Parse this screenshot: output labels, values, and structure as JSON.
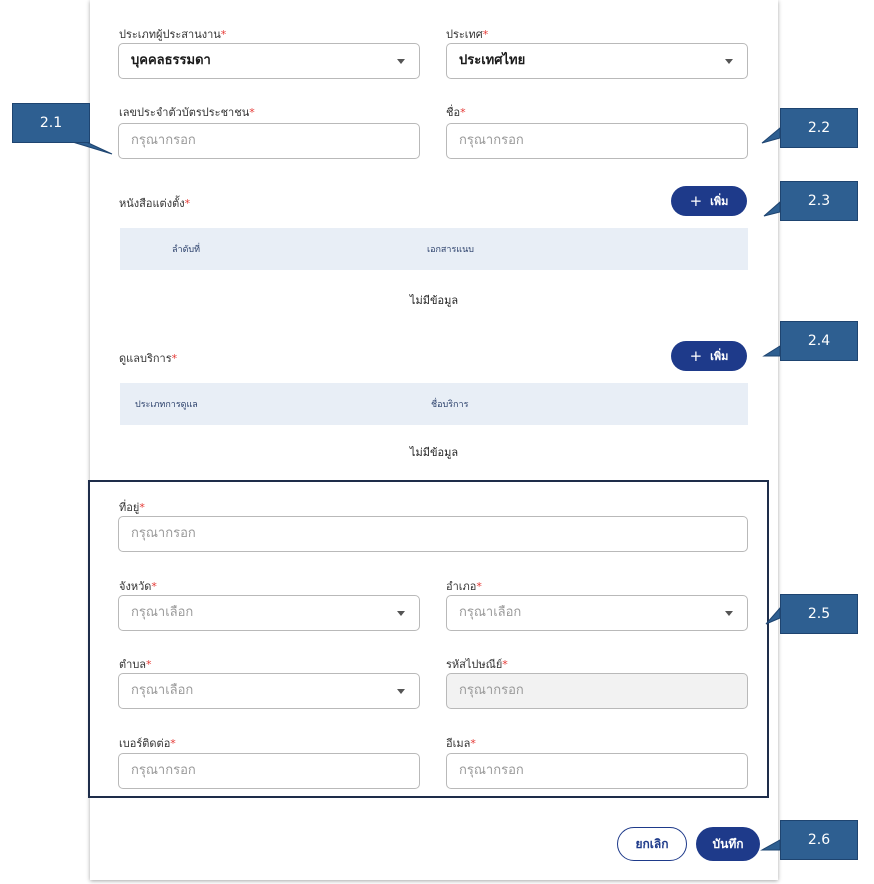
{
  "form": {
    "applicant_type": {
      "label": "ประเภทผู้ประสานงาน",
      "value": "บุคคลธรรมดา"
    },
    "country": {
      "label": "ประเทศ",
      "value": "ประเทศไทย"
    },
    "id_card": {
      "label": "เลขประจำตัวบัตรประชาชน",
      "placeholder": "กรุณากรอก"
    },
    "first_name": {
      "label": "ชื่อ",
      "placeholder": "กรุณากรอก"
    }
  },
  "appointment": {
    "title": "หนังสือแต่งตั้ง",
    "add_label": "เพิ่ม",
    "columns": [
      "ลำดับที่",
      "เอกสารแนบ"
    ],
    "empty": "ไม่มีข้อมูล"
  },
  "services": {
    "title": "ดูแลบริการ",
    "add_label": "เพิ่ม",
    "columns": [
      "ประเภทการดูแล",
      "ชื่อบริการ"
    ],
    "empty": "ไม่มีข้อมูล"
  },
  "address": {
    "address": {
      "label": "ที่อยู่",
      "placeholder": "กรุณากรอก"
    },
    "province": {
      "label": "จังหวัด",
      "placeholder": "กรุณาเลือก"
    },
    "district": {
      "label": "อำเภอ",
      "placeholder": "กรุณาเลือก"
    },
    "subdistrict": {
      "label": "ตำบล",
      "placeholder": "กรุณาเลือก"
    },
    "postcode": {
      "label": "รหัสไปษณีย์",
      "placeholder": "กรุณากรอก"
    },
    "phone": {
      "label": "เบอร์ติดต่อ",
      "placeholder": "กรุณากรอก"
    },
    "email": {
      "label": "อีเมล",
      "placeholder": "กรุณากรอก"
    }
  },
  "actions": {
    "cancel": "ยกเลิก",
    "save": "บันทึก"
  },
  "required_mark": "*",
  "callouts": [
    "2.1",
    "2.2",
    "2.3",
    "2.4",
    "2.5",
    "2.6"
  ],
  "colors": {
    "primary": "#1e3a8a",
    "callout": "#2e5f91",
    "required": "#e53935",
    "table_header": "#e8eef6"
  }
}
